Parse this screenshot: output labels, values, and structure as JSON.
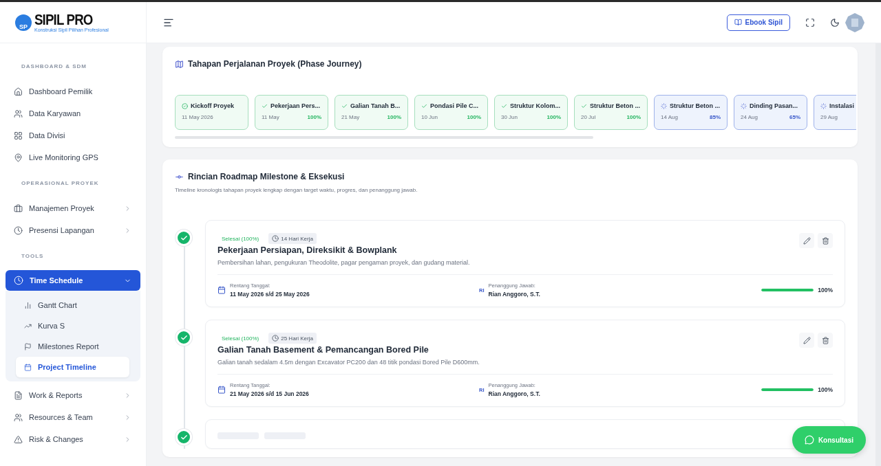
{
  "logo": {
    "mark": "SP",
    "name": "SIPIL PRO",
    "tagline": "Konstruksi Sipil Pilihan Profesional"
  },
  "header": {
    "ebook_button": "Ebook Sipil"
  },
  "sidebar": {
    "sections": [
      {
        "title": "DASHBOARD & SDM",
        "items": [
          {
            "label": "Dashboard Pemilik",
            "has_children": false,
            "selected": false
          },
          {
            "label": "Data Karyawan",
            "has_children": false,
            "selected": false
          },
          {
            "label": "Data Divisi",
            "has_children": false,
            "selected": false
          },
          {
            "label": "Live Monitoring GPS",
            "has_children": false,
            "selected": false
          }
        ]
      },
      {
        "title": "OPERASIONAL PROYEK",
        "items": [
          {
            "label": "Manajemen Proyek",
            "has_children": true,
            "expanded": false,
            "selected": false
          },
          {
            "label": "Presensi Lapangan",
            "has_children": true,
            "expanded": false,
            "selected": false
          }
        ]
      },
      {
        "title": "TOOLS",
        "items": [
          {
            "label": "Time Schedule",
            "has_children": true,
            "expanded": true,
            "selected": true,
            "children": [
              {
                "label": "Gantt Chart",
                "selected": false
              },
              {
                "label": "Kurva S",
                "selected": false
              },
              {
                "label": "Milestones Report",
                "selected": false
              },
              {
                "label": "Project Timeline",
                "selected": true
              }
            ]
          },
          {
            "label": "Work & Reports",
            "has_children": true,
            "expanded": false,
            "selected": false
          },
          {
            "label": "Resources & Team",
            "has_children": true,
            "expanded": false,
            "selected": false
          },
          {
            "label": "Risk & Changes",
            "has_children": true,
            "expanded": false,
            "selected": false
          }
        ]
      }
    ]
  },
  "phase_journey": {
    "title": "Tahapan Perjalanan Proyek (Phase Journey)",
    "phases": [
      {
        "kind": "start",
        "name": "Kickoff Proyek",
        "date": "11 May 2026"
      },
      {
        "kind": "done",
        "name": "Pekerjaan Pers...",
        "date": "11 May",
        "percent": "100%"
      },
      {
        "kind": "done",
        "name": "Galian Tanah B...",
        "date": "21 May",
        "percent": "100%"
      },
      {
        "kind": "done",
        "name": "Pondasi Pile C...",
        "date": "10 Jun",
        "percent": "100%"
      },
      {
        "kind": "done",
        "name": "Struktur Kolom...",
        "date": "30 Jun",
        "percent": "100%"
      },
      {
        "kind": "done",
        "name": "Struktur Beton ...",
        "date": "20 Jul",
        "percent": "100%"
      },
      {
        "kind": "progress",
        "name": "Struktur Beton ...",
        "date": "14 Aug",
        "percent": "85%"
      },
      {
        "kind": "progress",
        "name": "Dinding Pasan...",
        "date": "24 Aug",
        "percent": "65%"
      },
      {
        "kind": "progress",
        "name": "Instalasi",
        "date": "29 Aug"
      }
    ]
  },
  "roadmap": {
    "title": "Rincian Roadmap Milestone & Eksekusi",
    "subtitle": "Timeline kronologis tahapan proyek lengkap dengan target waktu, progres, dan penanggung jawab.",
    "milestones": [
      {
        "done": true,
        "status": "Selesai (100%)",
        "duration": "14 Hari Kerja",
        "title": "Pekerjaan Persiapan, Direksikit & Bowplank",
        "description": "Pembersihan lahan, pengukuran Theodolite, pagar pengaman proyek, dan gudang material.",
        "date_label": "Rentang Tanggal:",
        "date_range": "11 May 2026 s/d 25 May 2026",
        "owner_initials": "RI",
        "owner_label": "Penanggung Jawab:",
        "owner": "Rian Anggoro, S.T.",
        "level": 1,
        "percent": "100%"
      },
      {
        "done": true,
        "status": "Selesai (100%)",
        "duration": "25 Hari Kerja",
        "title": "Galian Tanah Basement & Pemancangan Bored Pile",
        "description": "Galian tanah sedalam 4.5m dengan Excavator PC200 dan 48 titik pondasi Bored Pile D600mm.",
        "date_label": "Rentang Tanggal:",
        "date_range": "21 May 2026 s/d 15 Jun 2026",
        "owner_initials": "RI",
        "owner_label": "Penanggung Jawab:",
        "owner": "Rian Anggoro, S.T.",
        "level": 1,
        "percent": "100%"
      },
      {
        "done": true
      }
    ]
  },
  "whatsapp_button": "Konsultasi"
}
